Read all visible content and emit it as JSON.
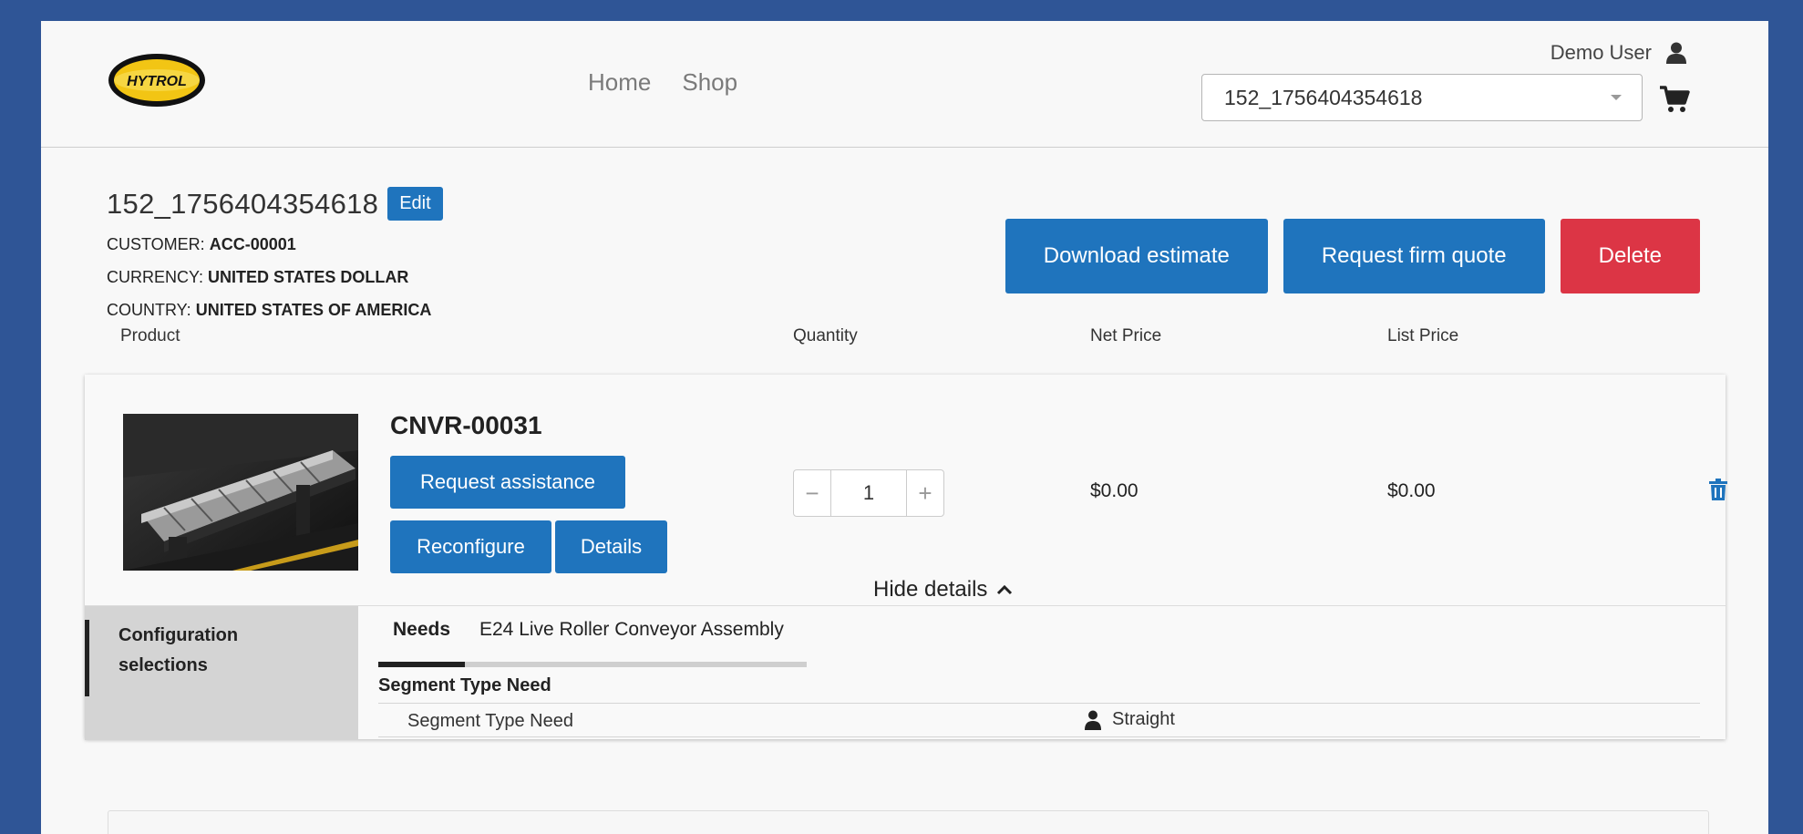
{
  "header": {
    "logo_text": "HYTROL",
    "nav": [
      {
        "label": "Home"
      },
      {
        "label": "Shop"
      }
    ],
    "user_name": "Demo User",
    "cart_selected": "152_1756404354618"
  },
  "quote": {
    "name": "152_1756404354618",
    "edit_label": "Edit",
    "customer_label": "CUSTOMER:",
    "customer_value": "ACC-00001",
    "currency_label": "CURRENCY:",
    "currency_value": "UNITED STATES DOLLAR",
    "country_label": "COUNTRY:",
    "country_value": "UNITED STATES OF AMERICA",
    "actions": {
      "download": "Download estimate",
      "request_quote": "Request firm quote",
      "delete": "Delete"
    }
  },
  "columns": {
    "product": "Product",
    "quantity": "Quantity",
    "net_price": "Net Price",
    "list_price": "List Price"
  },
  "line_item": {
    "sku": "CNVR-00031",
    "request_assistance": "Request assistance",
    "reconfigure": "Reconfigure",
    "details": "Details",
    "quantity": "1",
    "decrement": "−",
    "increment": "+",
    "net_price": "$0.00",
    "list_price": "$0.00",
    "hide_details": "Hide details"
  },
  "configuration": {
    "side_label": "Configuration selections",
    "tabs": [
      {
        "label": "Needs"
      },
      {
        "label": "E24 Live Roller Conveyor Assembly"
      }
    ],
    "active_tab": "Needs",
    "section_title": "Segment Type Need",
    "rows": [
      {
        "name": "Segment Type Need",
        "value": "Straight"
      }
    ]
  },
  "colors": {
    "primary": "#1f74bd",
    "danger": "#dc3545",
    "frame": "#2f5596",
    "logo_yellow": "#f2c514"
  },
  "icons": [
    "user-icon",
    "cart-icon",
    "caret-down-icon",
    "trash-icon",
    "chevron-up-icon",
    "person-icon"
  ]
}
